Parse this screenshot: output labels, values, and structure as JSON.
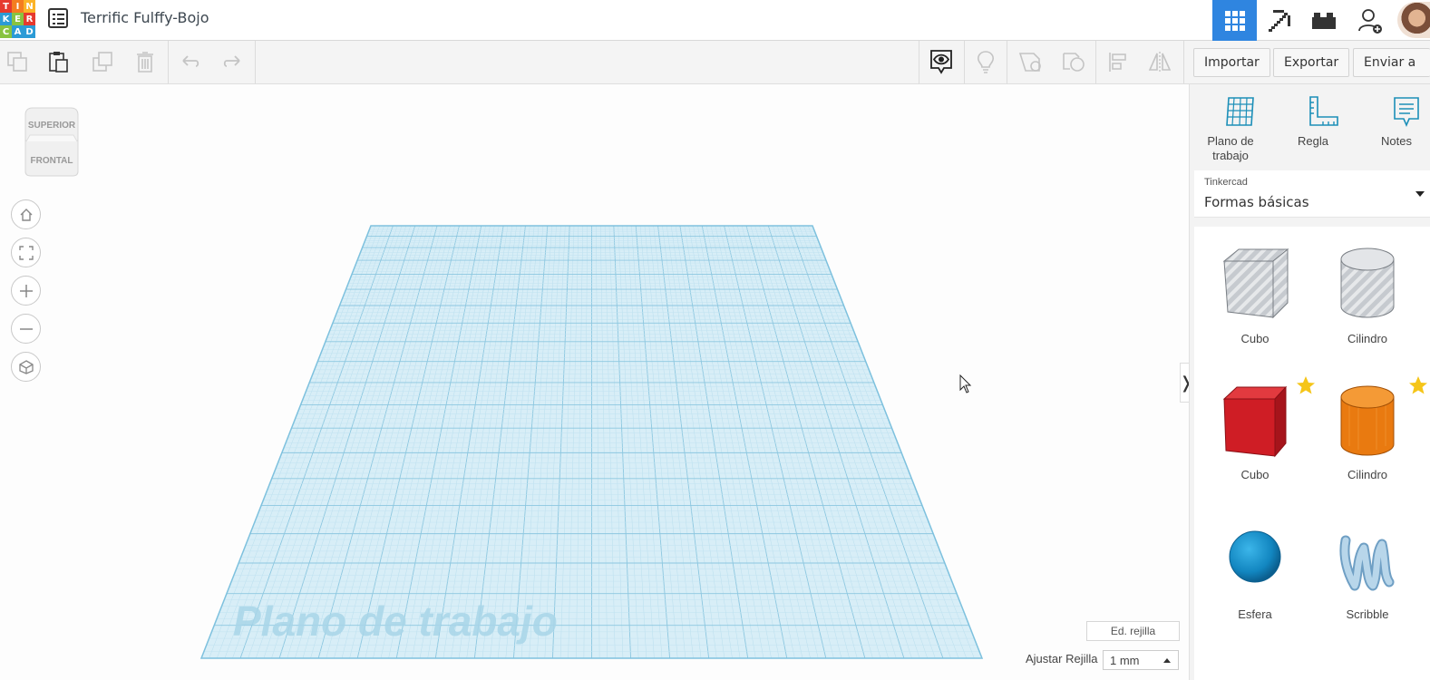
{
  "header": {
    "logo_letters": [
      "T",
      "I",
      "N",
      "K",
      "E",
      "R",
      "C",
      "A",
      "D"
    ],
    "logo_colors": [
      "#e63a2e",
      "#f47d20",
      "#fbb328",
      "#2b9bd6",
      "#88c340",
      "#e63a2e",
      "#88c340",
      "#2b9bd6",
      "#2b9bd6"
    ],
    "doc_title": "Terrific Fulffy-Bojo",
    "accent": "#2f85e0"
  },
  "toolbar": {
    "import_label": "Importar",
    "export_label": "Exportar",
    "send_label": "Enviar a"
  },
  "workspace": {
    "viewcube": {
      "top_label": "SUPERIOR",
      "front_label": "FRONTAL"
    },
    "workplane_label": "Plano de trabajo",
    "grid_edit_label": "Ed. rejilla",
    "snap_label": "Ajustar Rejilla",
    "snap_value": "1 mm",
    "collapse_glyph": "❭"
  },
  "panel": {
    "tools": [
      {
        "label": "Plano de trabajo"
      },
      {
        "label": "Regla"
      },
      {
        "label": "Notes"
      }
    ],
    "library_source": "Tinkercad",
    "library_name": "Formas básicas",
    "shapes": [
      {
        "name": "Cubo",
        "color": "#bfc3c8",
        "hole": true
      },
      {
        "name": "Cilindro",
        "color": "#bfc3c8",
        "hole": true
      },
      {
        "name": "Cubo",
        "color": "#d21f26",
        "favorite": true
      },
      {
        "name": "Cilindro",
        "color": "#f07f12",
        "favorite": true
      },
      {
        "name": "Esfera",
        "color": "#1593d0"
      },
      {
        "name": "Scribble",
        "color": "#9bc3de"
      }
    ]
  }
}
